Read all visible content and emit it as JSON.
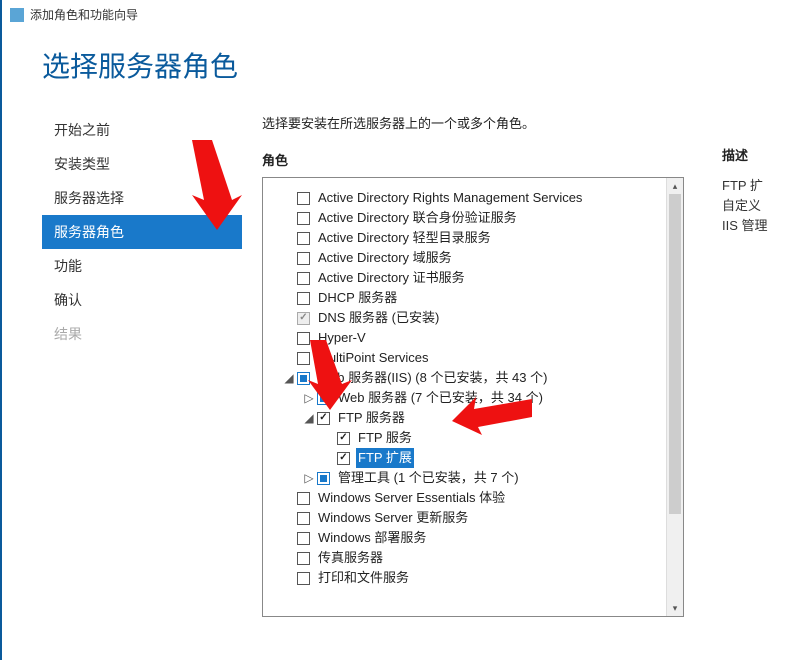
{
  "window_title": "添加角色和功能向导",
  "page_heading": "选择服务器角色",
  "steps": {
    "before": "开始之前",
    "type": "安装类型",
    "select": "服务器选择",
    "roles": "服务器角色",
    "features": "功能",
    "confirm": "确认",
    "results": "结果"
  },
  "instruction": "选择要安装在所选服务器上的一个或多个角色。",
  "roles_label": "角色",
  "desc_label": "描述",
  "desc_lines": {
    "l1": "FTP 扩",
    "l2": "自定义",
    "l3": "IIS 管理"
  },
  "tree": {
    "adrms": "Active Directory Rights Management Services",
    "adfs": "Active Directory 联合身份验证服务",
    "adlds": "Active Directory 轻型目录服务",
    "adds": "Active Directory 域服务",
    "adcs": "Active Directory 证书服务",
    "dhcp": "DHCP 服务器",
    "dns": "DNS 服务器 (已安装)",
    "hyperv": "Hyper-V",
    "multipoint": "MultiPoint Services",
    "iis": "Web 服务器(IIS) (8 个已安装，共 43 个)",
    "webserver": "Web 服务器 (7 个已安装，共 34 个)",
    "ftpserver": "FTP 服务器",
    "ftpservice": "FTP 服务",
    "ftpext": "FTP 扩展",
    "mgmt": "管理工具 (1 个已安装，共 7 个)",
    "wse": "Windows Server Essentials 体验",
    "wsus": "Windows Server 更新服务",
    "wds": "Windows 部署服务",
    "fax": "传真服务器",
    "print": "打印和文件服务"
  },
  "glyph": {
    "closed": "▷",
    "open": "◢"
  }
}
